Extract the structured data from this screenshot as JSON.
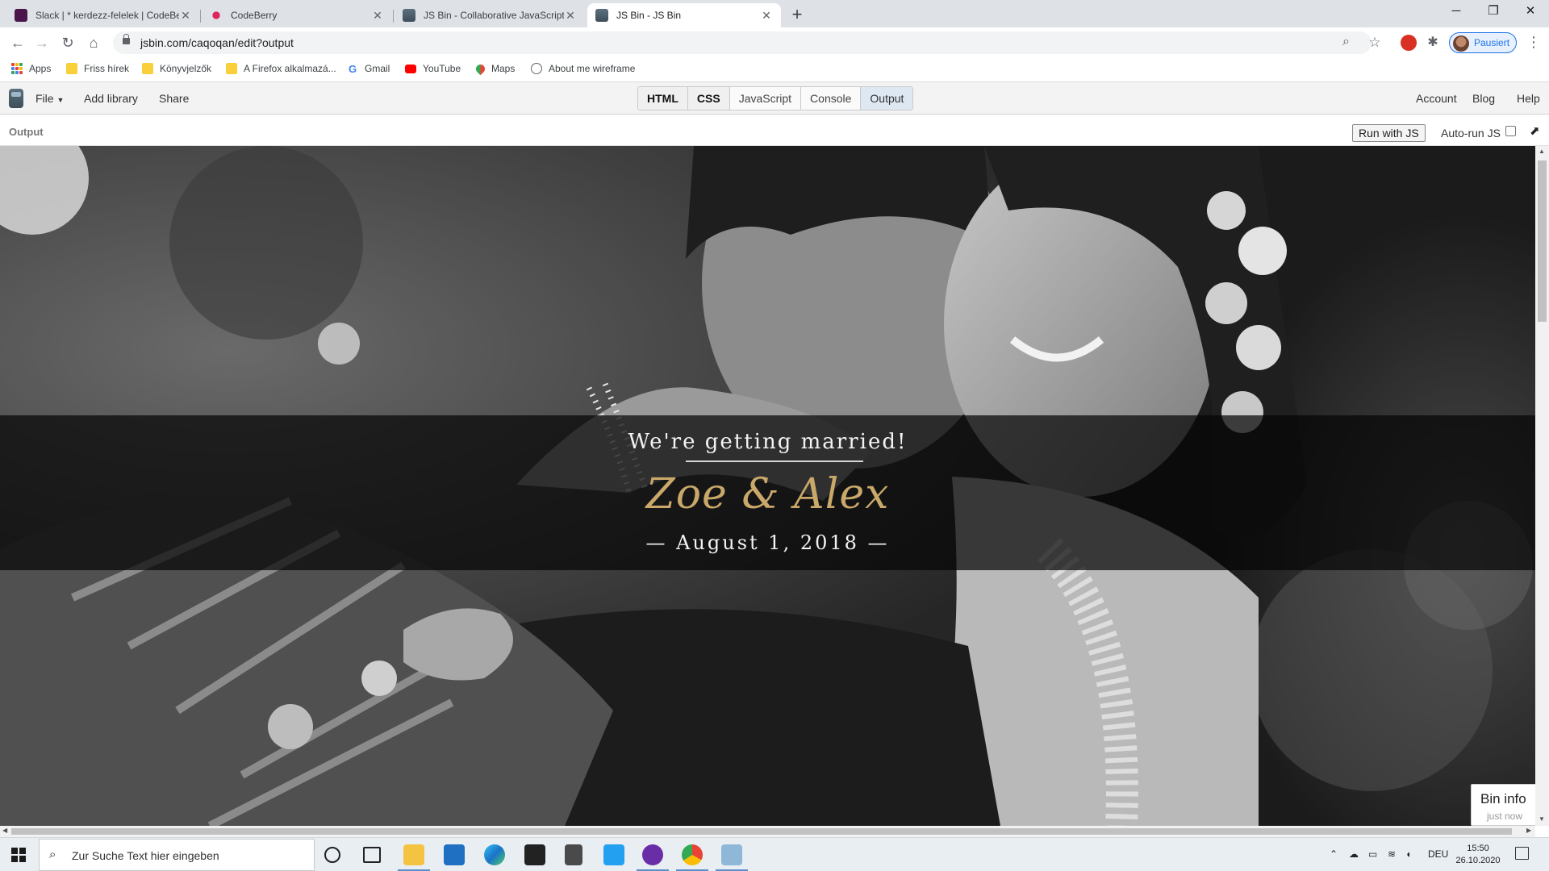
{
  "browser": {
    "tabs": [
      {
        "title": "Slack | * kerdezz-felelek | CodeBe",
        "favicon": "slack-icon",
        "active": false
      },
      {
        "title": "CodeBerry",
        "favicon": "codeberry-icon",
        "active": false
      },
      {
        "title": "JS Bin - Collaborative JavaScript D",
        "favicon": "jsbin-icon",
        "active": false
      },
      {
        "title": "JS Bin - JS Bin",
        "favicon": "jsbin-icon",
        "active": true
      }
    ],
    "url": "jsbin.com/caqoqan/edit?output",
    "profile_label": "Pausiert",
    "bookmarks": [
      {
        "label": "Apps",
        "icon": "apps-grid-icon"
      },
      {
        "label": "Friss hírek",
        "icon": "folder-icon"
      },
      {
        "label": "Könyvjelzők",
        "icon": "folder-icon"
      },
      {
        "label": "A Firefox alkalmazá...",
        "icon": "folder-icon"
      },
      {
        "label": "Gmail",
        "icon": "google-icon"
      },
      {
        "label": "YouTube",
        "icon": "youtube-icon"
      },
      {
        "label": "Maps",
        "icon": "maps-icon"
      },
      {
        "label": "About me wireframe",
        "icon": "globe-icon"
      }
    ]
  },
  "jsbin": {
    "menu": {
      "file": "File",
      "add_library": "Add library",
      "share": "Share"
    },
    "panels": [
      "HTML",
      "CSS",
      "JavaScript",
      "Console",
      "Output"
    ],
    "right_links": {
      "account": "Account",
      "blog": "Blog",
      "help": "Help"
    },
    "output_label": "Output",
    "run_button": "Run with JS",
    "autorun_label": "Auto-run JS",
    "bin_info": {
      "title": "Bin info",
      "time": "just now"
    }
  },
  "page": {
    "headline": "We're getting married!",
    "names": "Zoe & Alex",
    "date": "— August 1, 2018 —"
  },
  "taskbar": {
    "search_placeholder": "Zur Suche Text hier eingeben",
    "language": "DEU",
    "time": "15:50",
    "date": "26.10.2020"
  },
  "colors": {
    "accent_gold": "#c9a86a",
    "jsbin_output_tab": "#dde8f2",
    "chrome_blue": "#1a73e8"
  }
}
